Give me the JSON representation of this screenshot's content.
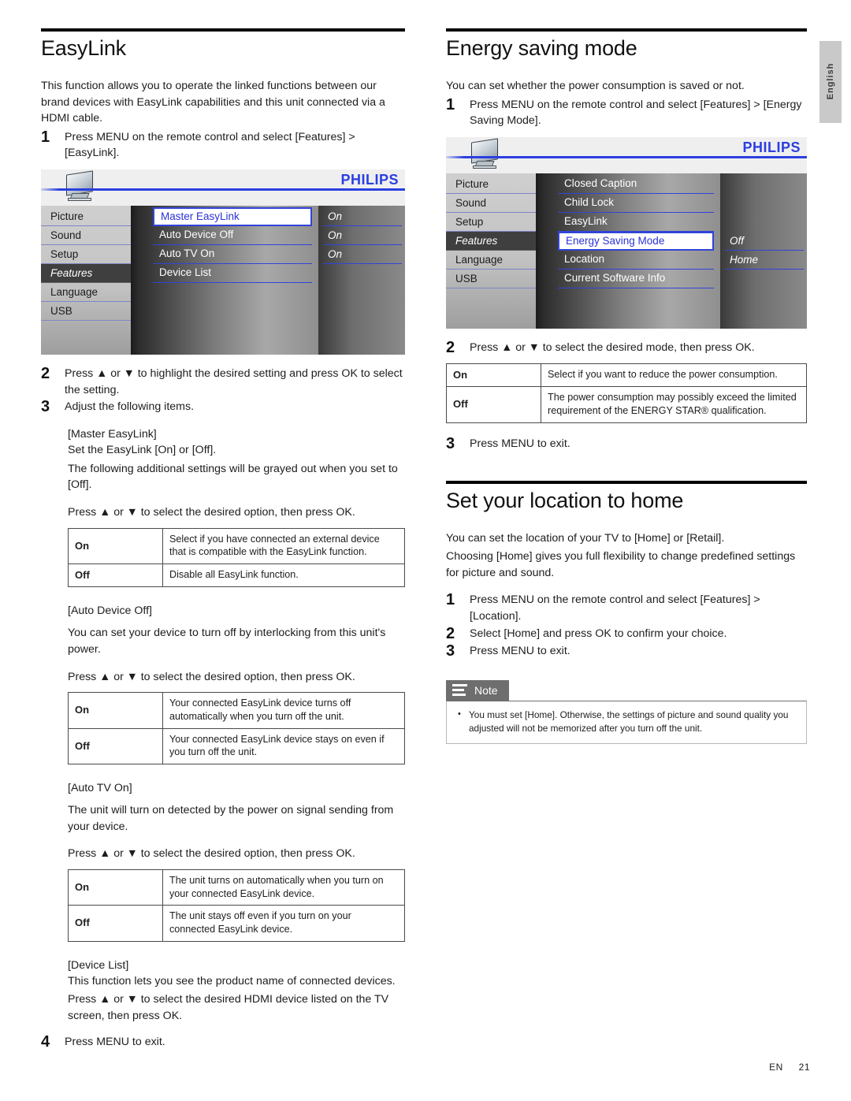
{
  "lang_tab": "English",
  "footer": {
    "code": "EN",
    "page": "21"
  },
  "brand": "PHILIPS",
  "left": {
    "title": "EasyLink",
    "intro": "This function allows you to operate the linked functions between our brand devices with EasyLink capabilities and this unit connected via a HDMI cable.",
    "step1_num": "1",
    "step1_text": "Press MENU on the remote control and select [Features] > [EasyLink].",
    "osd": {
      "sidebar": [
        "Picture",
        "Sound",
        "Setup",
        "Features",
        "Language",
        "USB"
      ],
      "sidebar_selected": "Features",
      "items": [
        "Master EasyLink",
        "Auto Device Off",
        "Auto TV On",
        "Device List"
      ],
      "item_selected": "Master EasyLink",
      "values": [
        "On",
        "On",
        "On",
        ""
      ]
    },
    "step2_num": "2",
    "step2_text": "Press ▲ or ▼ to highlight the desired setting and press OK to select the setting.",
    "step3_num": "3",
    "step3_text": "Adjust the following items.",
    "master": {
      "head": "[Master EasyLink]",
      "line1": "Set the EasyLink [On] or [Off].",
      "line2": "The following additional settings will be grayed out when you set to [Off].",
      "press": "Press ▲ or ▼ to select the desired option, then press OK.",
      "table": [
        {
          "key": "On",
          "desc": "Select if you have connected an external device that is compatible with the EasyLink function."
        },
        {
          "key": "Off",
          "desc": "Disable all EasyLink function."
        }
      ]
    },
    "auto_device_off": {
      "head": "[Auto Device Off]",
      "line1": "You can set your device to turn off by interlocking from this unit's power.",
      "press": "Press ▲ or ▼ to select the desired option, then press OK.",
      "table": [
        {
          "key": "On",
          "desc": "Your connected EasyLink device turns off automatically when you turn off the unit."
        },
        {
          "key": "Off",
          "desc": "Your connected EasyLink device stays on even if you turn off the unit."
        }
      ]
    },
    "auto_tv_on": {
      "head": "[Auto TV On]",
      "line1": "The unit will turn on detected by the power on signal sending from your device.",
      "press": "Press ▲ or ▼ to select the desired option, then press OK.",
      "table": [
        {
          "key": "On",
          "desc": "The unit turns on automatically when you turn on your connected EasyLink device."
        },
        {
          "key": "Off",
          "desc": "The unit stays off even if you turn on your connected EasyLink device."
        }
      ]
    },
    "device_list": {
      "head": "[Device List]",
      "line1": "This function lets you see the product name of connected devices.",
      "line2": "Press ▲ or ▼ to select the desired HDMI device listed on the TV screen, then press OK."
    },
    "step4_num": "4",
    "step4_text": "Press MENU to exit."
  },
  "right": {
    "energy": {
      "title": "Energy saving mode",
      "intro": "You can set whether the power consumption is saved or not.",
      "step1_num": "1",
      "step1_text": "Press MENU on the remote control and select [Features] > [Energy Saving Mode].",
      "osd": {
        "sidebar": [
          "Picture",
          "Sound",
          "Setup",
          "Features",
          "Language",
          "USB"
        ],
        "sidebar_selected": "Features",
        "items": [
          "Closed Caption",
          "Child Lock",
          "EasyLink",
          "Energy Saving Mode",
          "Location",
          "Current Software Info"
        ],
        "item_selected": "Energy Saving Mode",
        "values": [
          "",
          "",
          "",
          "Off",
          "Home",
          ""
        ]
      },
      "step2_num": "2",
      "step2_text": "Press ▲ or ▼ to select the desired mode, then press OK.",
      "table": [
        {
          "key": "On",
          "desc": "Select if you want to reduce the power consumption."
        },
        {
          "key": "Off",
          "desc": "The power consumption may possibly exceed the limited requirement of the ENERGY STAR® qualification."
        }
      ],
      "step3_num": "3",
      "step3_text": "Press MENU to exit."
    },
    "location": {
      "title": "Set your location to home",
      "intro1": "You can set the location of your TV to [Home] or [Retail].",
      "intro2": "Choosing [Home] gives you full flexibility to change predefined settings for picture and sound.",
      "step1_num": "1",
      "step1_text": "Press MENU on the remote control and select [Features] > [Location].",
      "step2_num": "2",
      "step2_text": "Select [Home] and press OK to confirm your choice.",
      "step3_num": "3",
      "step3_text": "Press MENU to exit."
    },
    "note": {
      "label": "Note",
      "items": [
        "You must set [Home]. Otherwise, the settings of picture and sound quality you adjusted will not be memorized after you turn off the unit."
      ]
    }
  }
}
